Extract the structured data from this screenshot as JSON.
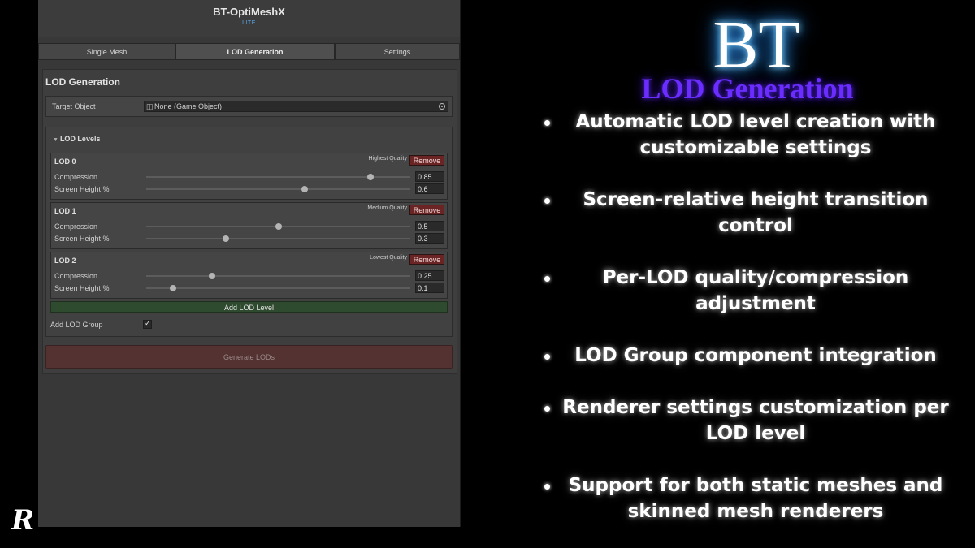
{
  "window": {
    "title": "BT-OptiMeshX",
    "badge": "LITE"
  },
  "tabs": [
    {
      "label": "Single Mesh",
      "active": false
    },
    {
      "label": "LOD Generation",
      "active": true
    },
    {
      "label": "Settings",
      "active": false
    }
  ],
  "panel": {
    "title": "LOD Generation",
    "target": {
      "label": "Target Object",
      "value": "None (Game Object)"
    },
    "lod_section_title": "LOD Levels",
    "lods": [
      {
        "name": "LOD 0",
        "quality": "Highest Quality",
        "remove_label": "Remove",
        "compression_label": "Compression",
        "compression": 0.85,
        "screen_height_label": "Screen Height %",
        "screen_height": 0.6
      },
      {
        "name": "LOD 1",
        "quality": "Medium Quality",
        "remove_label": "Remove",
        "compression_label": "Compression",
        "compression": 0.5,
        "screen_height_label": "Screen Height %",
        "screen_height": 0.3
      },
      {
        "name": "LOD 2",
        "quality": "Lowest Quality",
        "remove_label": "Remove",
        "compression_label": "Compression",
        "compression": 0.25,
        "screen_height_label": "Screen Height %",
        "screen_height": 0.1
      }
    ],
    "add_lod_label": "Add LOD Level",
    "lod_group_label": "Add LOD Group",
    "lod_group_checked": true,
    "generate_label": "Generate LODs"
  },
  "promo": {
    "logo": "BT",
    "heading": "LOD Generation",
    "features": [
      "Automatic LOD level creation with customizable settings",
      "Screen-relative height transition control",
      "Per-LOD quality/compression adjustment",
      "LOD Group component integration",
      "Renderer settings customization per LOD level",
      "Support for both static meshes and skinned mesh renderers"
    ]
  },
  "corner_logo": "R",
  "icons": {
    "object_field": "game-object-icon",
    "picker": "object-picker-icon",
    "foldout": "triangle-down-icon",
    "check": "checkmark-icon"
  },
  "colors": {
    "remove_button": "#6a2424",
    "add_button": "#2f4b2f",
    "generate_button": "#553232",
    "heading_purple": "#6a2cff",
    "logo_glow": "#3aa8ff",
    "badge_blue": "#5aa6e8"
  }
}
